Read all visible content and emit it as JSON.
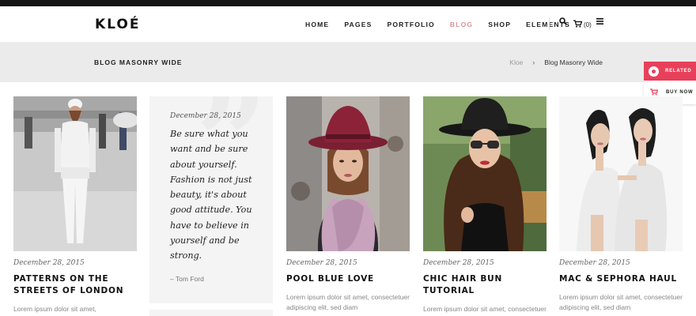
{
  "header": {
    "logo": "KLOÉ",
    "nav": [
      {
        "label": "HOME",
        "active": false
      },
      {
        "label": "PAGES",
        "active": false
      },
      {
        "label": "PORTFOLIO",
        "active": false
      },
      {
        "label": "BLOG",
        "active": true
      },
      {
        "label": "SHOP",
        "active": false
      },
      {
        "label": "ELEMENTS",
        "active": false
      }
    ],
    "cart_count": "(0)",
    "icons": [
      "search-icon",
      "cart-icon",
      "menu-icon"
    ]
  },
  "titlebar": {
    "title": "BLOG MASONRY WIDE",
    "breadcrumb_home": "Kloe",
    "breadcrumb_sep": "›",
    "breadcrumb_current": "Blog Masonry Wide"
  },
  "side_widget": {
    "related": "RELATED",
    "buy_now": "BUY NOW"
  },
  "posts": [
    {
      "date": "December 28, 2015",
      "title": "PATTERNS ON THE STREETS OF LONDON",
      "excerpt": "Lorem ipsum dolor sit amet,"
    },
    {
      "date": "December 28, 2015",
      "title": "POOL BLUE LOVE",
      "excerpt": "Lorem ipsum dolor sit amet, consectetuer adipiscing elit, sed diam"
    },
    {
      "date": "December 28, 2015",
      "title": "CHIC HAIR BUN TUTORIAL",
      "excerpt": "Lorem ipsum dolor sit amet, consectetuer adipiscing elit, sed diam"
    },
    {
      "date": "December 28, 2015",
      "title": "MAC & SEPHORA HAUL",
      "excerpt": "Lorem ipsum dolor sit amet, consectetuer adipiscing elit, sed diam"
    }
  ],
  "quote_post": {
    "date": "December 28, 2015",
    "text": "Be sure what you want and be sure about yourself. Fashion is not just beauty, it's about good attitude. You have to believe in yourself and be strong.",
    "author": "– Tom Ford"
  },
  "colors": {
    "accent": "#d4959a",
    "related_bg": "#e8405a",
    "titlebar_bg": "#ebebeb",
    "topbar_bg": "#151515"
  }
}
